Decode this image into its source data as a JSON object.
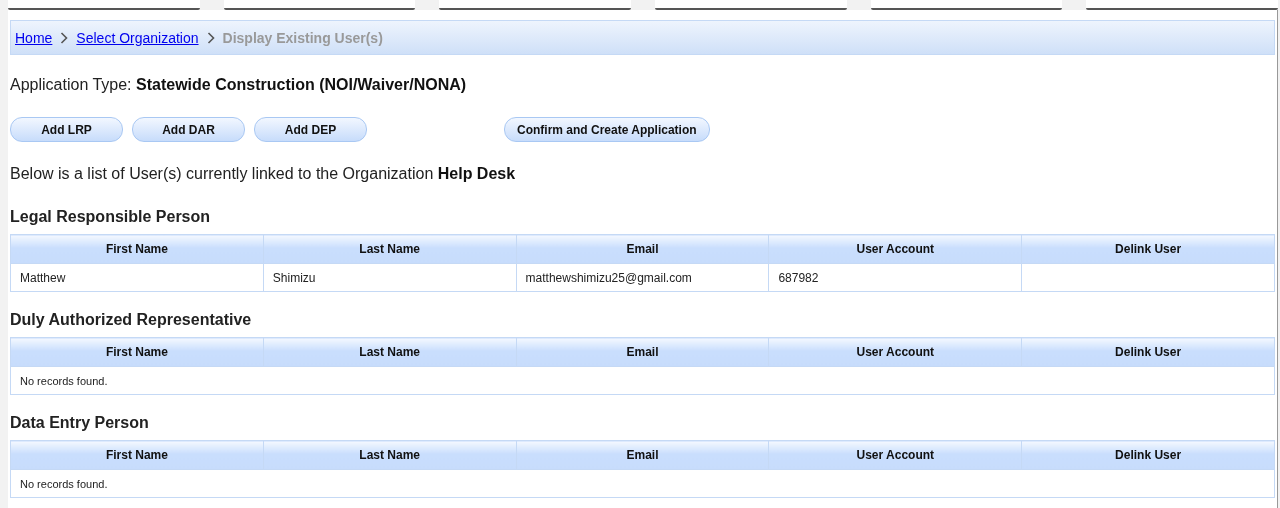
{
  "breadcrumb": [
    {
      "label": "Home",
      "kind": "link"
    },
    {
      "label": "Select Organization",
      "kind": "link"
    },
    {
      "label": "Display Existing User(s)",
      "kind": "current"
    }
  ],
  "application_type": {
    "label": "Application Type:",
    "value": "Statewide Construction (NOI/Waiver/NONA)"
  },
  "add_buttons": [
    "Add LRP",
    "Add DAR",
    "Add DEP"
  ],
  "confirm_button": "Confirm and Create Application",
  "intro": "Below is a list of User(s) currently linked to the Organization **Help Desk**",
  "sections": [
    {
      "title": "Legal Responsible Person",
      "columns": [
        "First Name",
        "Last Name",
        "Email",
        "User Account",
        "Delink User"
      ],
      "rows": [
        [
          "Matthew",
          "Shimizu",
          "matthewshimizu25@gmail.com",
          "687982",
          ""
        ]
      ]
    },
    {
      "title": "Duly Authorized Representative",
      "columns": [
        "First Name",
        "Last Name",
        "Email",
        "User Account",
        "Delink User"
      ],
      "empty_message": "No records found."
    },
    {
      "title": "Data Entry Person",
      "columns": [
        "First Name",
        "Last Name",
        "Email",
        "User Account",
        "Delink User"
      ],
      "empty_message": "No records found."
    }
  ]
}
